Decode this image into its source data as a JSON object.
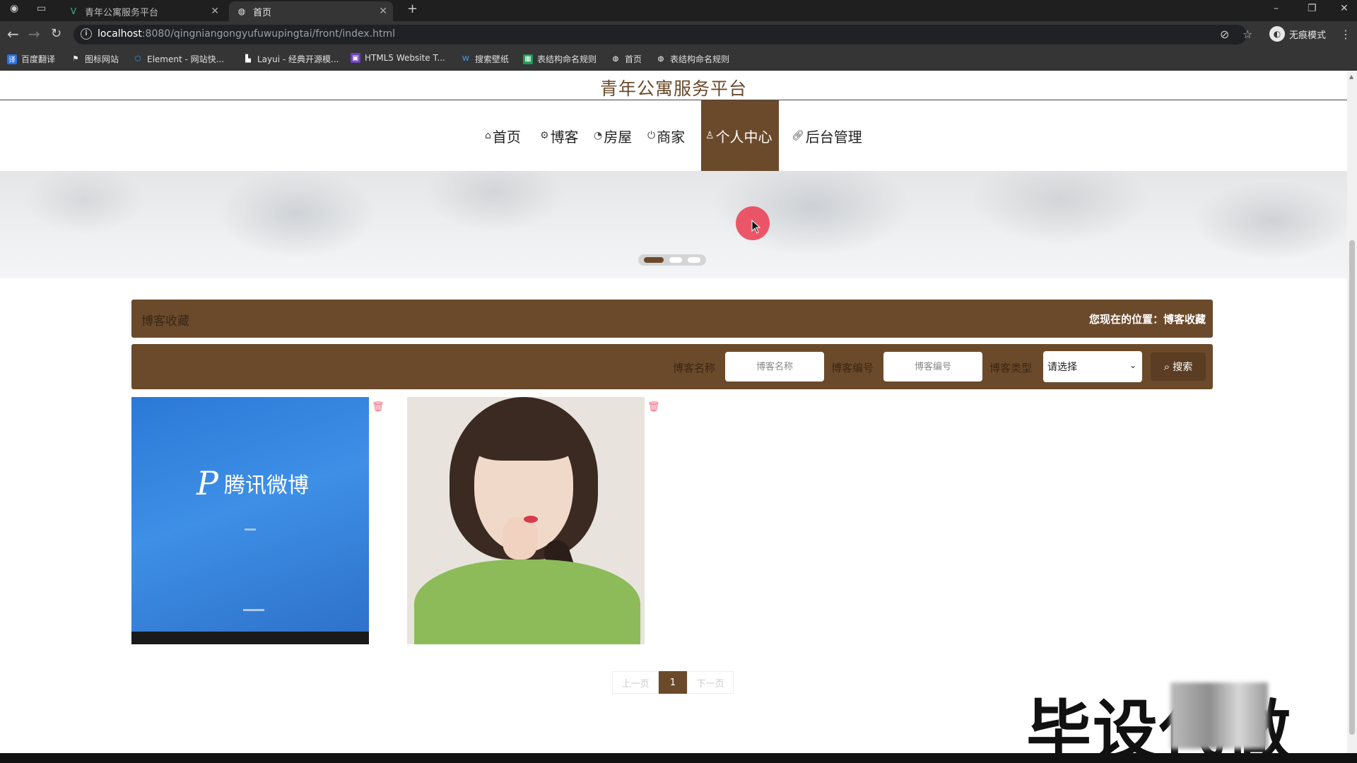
{
  "browser": {
    "tabs": [
      {
        "title": "青年公寓服务平台",
        "active": false
      },
      {
        "title": "首页",
        "active": true
      }
    ],
    "new_tab": "+",
    "url_host": "localhost",
    "url_rest": ":8080/qingniangongyufuwupingtai/front/index.html",
    "incognito_label": "无痕模式",
    "bookmarks": [
      "百度翻译",
      "图标网站",
      "Element - 网站快...",
      "Layui - 经典开源模...",
      "HTML5 Website T...",
      "搜索壁纸",
      "表结构命名规则",
      "首页",
      "表结构命名规则"
    ]
  },
  "site": {
    "title": "青年公寓服务平台",
    "nav": [
      {
        "label": "首页",
        "icon": "home-icon"
      },
      {
        "label": "博客",
        "icon": "gear-icon"
      },
      {
        "label": "房屋",
        "icon": "gauge-icon"
      },
      {
        "label": "商家",
        "icon": "power-icon"
      },
      {
        "label": "个人中心",
        "icon": "user-icon",
        "active": true
      },
      {
        "label": "后台管理",
        "icon": "link-icon"
      }
    ],
    "accent": "#6b4a2b"
  },
  "breadcrumb": {
    "section": "博客收藏",
    "location": "您现在的位置：博客收藏"
  },
  "search": {
    "name_label": "博客名称",
    "name_placeholder": "博客名称",
    "code_label": "博客编号",
    "code_placeholder": "博客编号",
    "type_label": "博客类型",
    "type_selected": "请选择",
    "button": "搜索"
  },
  "cards": [
    {
      "image": "腾讯微博"
    },
    {
      "image": "girl-photo"
    }
  ],
  "pager": {
    "prev": "上一页",
    "current": "1",
    "next": "下一页"
  },
  "watermark": "毕设代做"
}
